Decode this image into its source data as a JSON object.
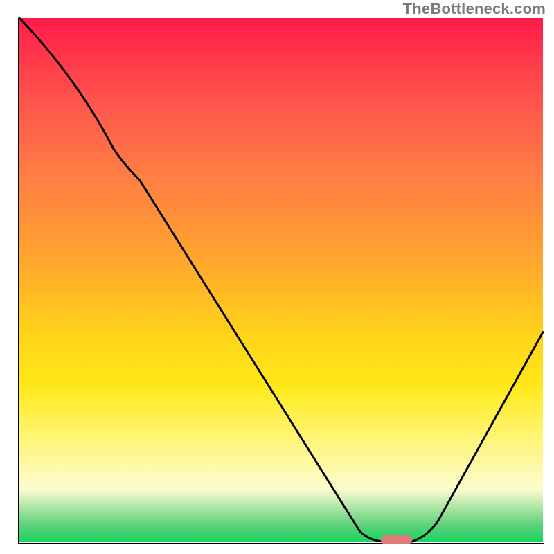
{
  "watermark": "TheBottleneck.com",
  "chart_data": {
    "type": "line",
    "title": "",
    "xlabel": "",
    "ylabel": "",
    "xlim": [
      0,
      100
    ],
    "ylim": [
      0,
      100
    ],
    "grid": false,
    "legend": false,
    "annotations": [],
    "gradient_stops": [
      {
        "pos": 0,
        "color": "#ff1b49",
        "meaning": "worst"
      },
      {
        "pos": 50,
        "color": "#ffd21a"
      },
      {
        "pos": 90,
        "color": "#fdfbd0"
      },
      {
        "pos": 100,
        "color": "#17d65f",
        "meaning": "best"
      }
    ],
    "series": [
      {
        "name": "bottleneck-curve",
        "x": [
          0,
          18,
          20,
          65,
          70,
          75,
          100
        ],
        "y": [
          100,
          75,
          72,
          2,
          0,
          0,
          40
        ]
      }
    ],
    "optimal_marker": {
      "x": 72,
      "y": 0,
      "width_pct": 6
    }
  },
  "colors": {
    "curve": "#000000",
    "marker": "#e07a7a",
    "axis": "#000000",
    "watermark": "#7a7a7a"
  }
}
